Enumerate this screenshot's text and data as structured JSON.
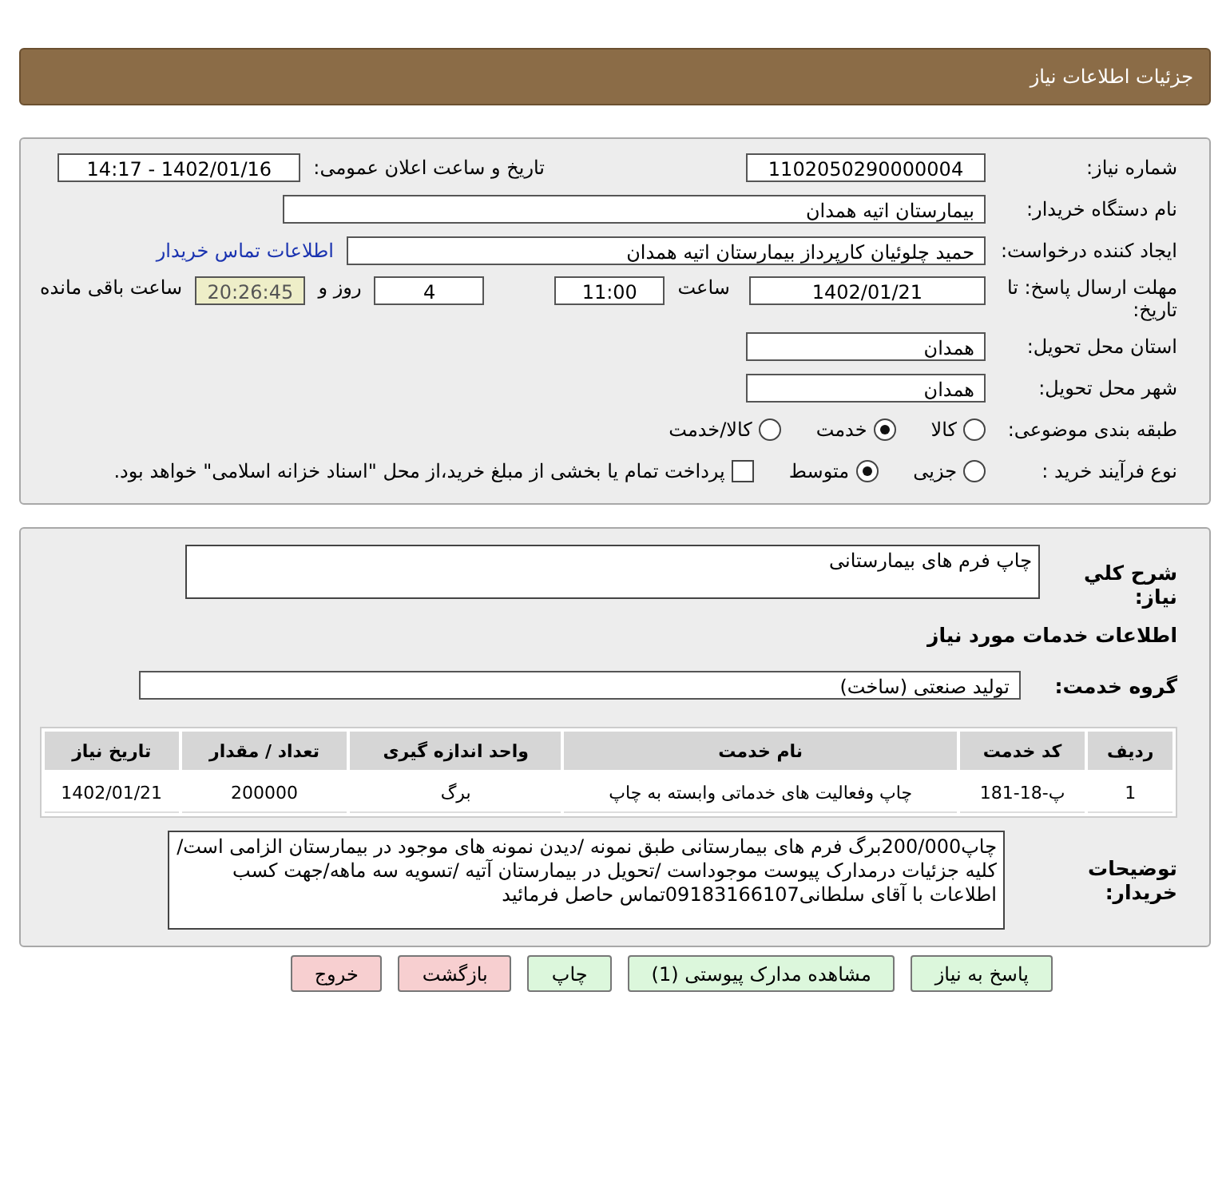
{
  "header": {
    "title": "جزئیات اطلاعات نیاز"
  },
  "details": {
    "need_number": {
      "label": "شماره نیاز:",
      "value": "1102050290000004"
    },
    "announce": {
      "label": "تاریخ و ساعت اعلان عمومی:",
      "value": "1402/01/16 - 14:17"
    },
    "buyer_org": {
      "label": "نام دستگاه خریدار:",
      "value": "بیمارستان اتیه همدان"
    },
    "requester": {
      "label": "ایجاد کننده درخواست:",
      "value": "حمید چلوئیان  کارپرداز بیمارستان اتیه همدان",
      "link": "اطلاعات تماس خریدار"
    },
    "deadline": {
      "label": "مهلت ارسال پاسخ: تا تاریخ:",
      "date": "1402/01/21",
      "time_label": "ساعت",
      "time": "11:00",
      "days": "4",
      "days_label": "روز و",
      "remaining": "20:26:45",
      "remaining_label": "ساعت باقی مانده"
    },
    "province": {
      "label": "استان محل تحویل:",
      "value": "همدان"
    },
    "city": {
      "label": "شهر محل تحویل:",
      "value": "همدان"
    },
    "category": {
      "label": "طبقه بندی موضوعی:",
      "options": [
        {
          "label": "کالا",
          "selected": false
        },
        {
          "label": "خدمت",
          "selected": true
        },
        {
          "label": "کالا/خدمت",
          "selected": false
        }
      ]
    },
    "process": {
      "label": "نوع فرآیند خرید :",
      "options": [
        {
          "label": "جزیی",
          "selected": false
        },
        {
          "label": "متوسط",
          "selected": true
        }
      ],
      "payment": {
        "checked": false,
        "text": "پرداخت تمام یا بخشی از مبلغ خرید،از محل \"اسناد خزانه اسلامی\" خواهد بود."
      }
    }
  },
  "need": {
    "description": {
      "label": "شرح کلي نياز:",
      "value": "چاپ فرم های بیمارستانی"
    },
    "services_title": "اطلاعات خدمات مورد نیاز",
    "group": {
      "label": "گروه خدمت:",
      "value": "تولید صنعتی (ساخت)"
    },
    "table": {
      "columns": [
        "ردیف",
        "کد خدمت",
        "نام خدمت",
        "واحد اندازه گیری",
        "تعداد / مقدار",
        "تاریخ نیاز"
      ],
      "rows": [
        [
          "1",
          "پ-18-181",
          "چاپ وفعالیت های خدماتی وابسته به چاپ",
          "برگ",
          "200000",
          "1402/01/21"
        ]
      ]
    },
    "notes": {
      "label": "توضیحات خریدار:",
      "value": "چاپ200/000برگ فرم های بیمارستانی طبق نمونه /دیدن نمونه های موجود در بیمارستان الزامی است/کلیه جزئیات درمدارک پیوست موجوداست /تحویل در بیمارستان آتیه /تسویه  سه ماهه/جهت کسب اطلاعات با آقای سلطانی09183166107تماس حاصل فرمائید"
    }
  },
  "buttons": [
    {
      "label": "پاسخ به نیاز",
      "kind": "normal"
    },
    {
      "label": "مشاهده مدارک پیوستی (1)",
      "kind": "normal"
    },
    {
      "label": "چاپ",
      "kind": "normal"
    },
    {
      "label": "بازگشت",
      "kind": "danger"
    },
    {
      "label": "خروج",
      "kind": "danger"
    }
  ]
}
